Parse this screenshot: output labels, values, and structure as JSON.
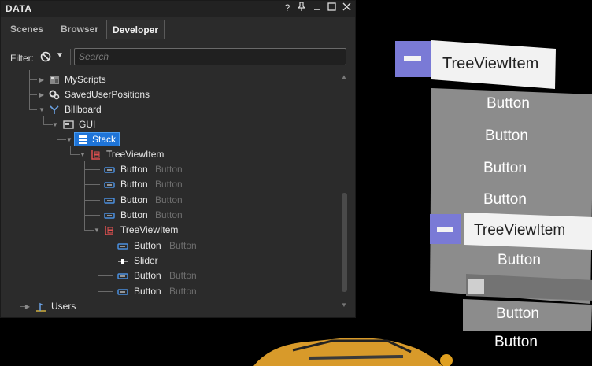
{
  "window": {
    "title": "DATA",
    "buttons": {
      "help": "?",
      "pin": "↑",
      "minimize": "—",
      "maximize": "☐",
      "close": "✕"
    }
  },
  "tabs": [
    {
      "label": "Scenes",
      "active": false
    },
    {
      "label": "Browser",
      "active": false
    },
    {
      "label": "Developer",
      "active": true
    }
  ],
  "filter": {
    "label": "Filter:",
    "search_placeholder": "Search"
  },
  "tree": {
    "myscripts": "MyScripts",
    "saveduserpositions": "SavedUserPositions",
    "billboard": "Billboard",
    "gui": "GUI",
    "stack": "Stack",
    "treeviewitem1": "TreeViewItem",
    "button1": {
      "name": "Button",
      "type": "Button"
    },
    "button2": {
      "name": "Button",
      "type": "Button"
    },
    "button3": {
      "name": "Button",
      "type": "Button"
    },
    "button4": {
      "name": "Button",
      "type": "Button"
    },
    "treeviewitem2": "TreeViewItem",
    "button5": {
      "name": "Button",
      "type": "Button"
    },
    "slider": "Slider",
    "button6": {
      "name": "Button",
      "type": "Button"
    },
    "button7": {
      "name": "Button",
      "type": "Button"
    },
    "users": "Users"
  },
  "scene": {
    "header1": "TreeViewItem",
    "buttons_a": [
      "Button",
      "Button",
      "Button",
      "Button"
    ],
    "header2": "TreeViewItem",
    "button_b": "Button",
    "buttons_c": [
      "Button",
      "Button"
    ]
  },
  "colors": {
    "selection": "#1e74d8",
    "icon_accent": "#7a7ad6",
    "panel_gray": "#8c8c8c"
  }
}
